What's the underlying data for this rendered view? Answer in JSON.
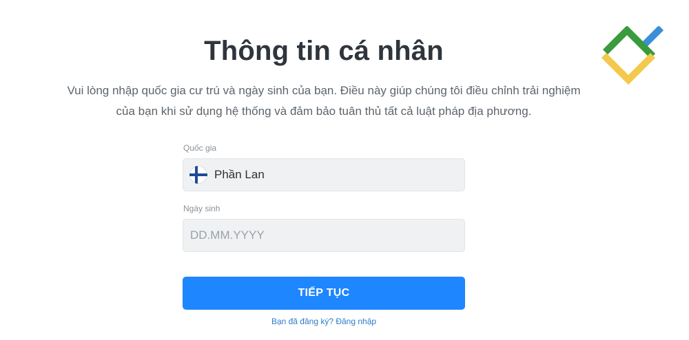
{
  "header": {
    "title": "Thông tin cá nhân",
    "subtitle_line1": "Vui lòng nhập quốc gia cư trú và ngày sinh của bạn. Điều này giúp chúng tôi điều chỉnh trải nghiệm",
    "subtitle_line2": "của bạn khi sử dụng hệ thống và đảm bảo tuân thủ tất cả luật pháp địa phương."
  },
  "logo": {
    "icon": "brand-logo-icon",
    "colors": {
      "green": "#3a9a3e",
      "yellow": "#f2c94c",
      "blue": "#3b8fd9"
    }
  },
  "form": {
    "country": {
      "label": "Quốc gia",
      "value": "Phần Lan",
      "flag_icon": "finland-flag-icon"
    },
    "birthdate": {
      "label": "Ngày sinh",
      "value": "",
      "placeholder": "DD.MM.YYYY"
    },
    "submit_label": "TIẾP TỤC",
    "login_link": "Bạn đã đăng ký? Đăng nhập"
  },
  "colors": {
    "accent": "#1e86ff",
    "link": "#2e7bc9",
    "field_bg": "#f0f1f2"
  }
}
